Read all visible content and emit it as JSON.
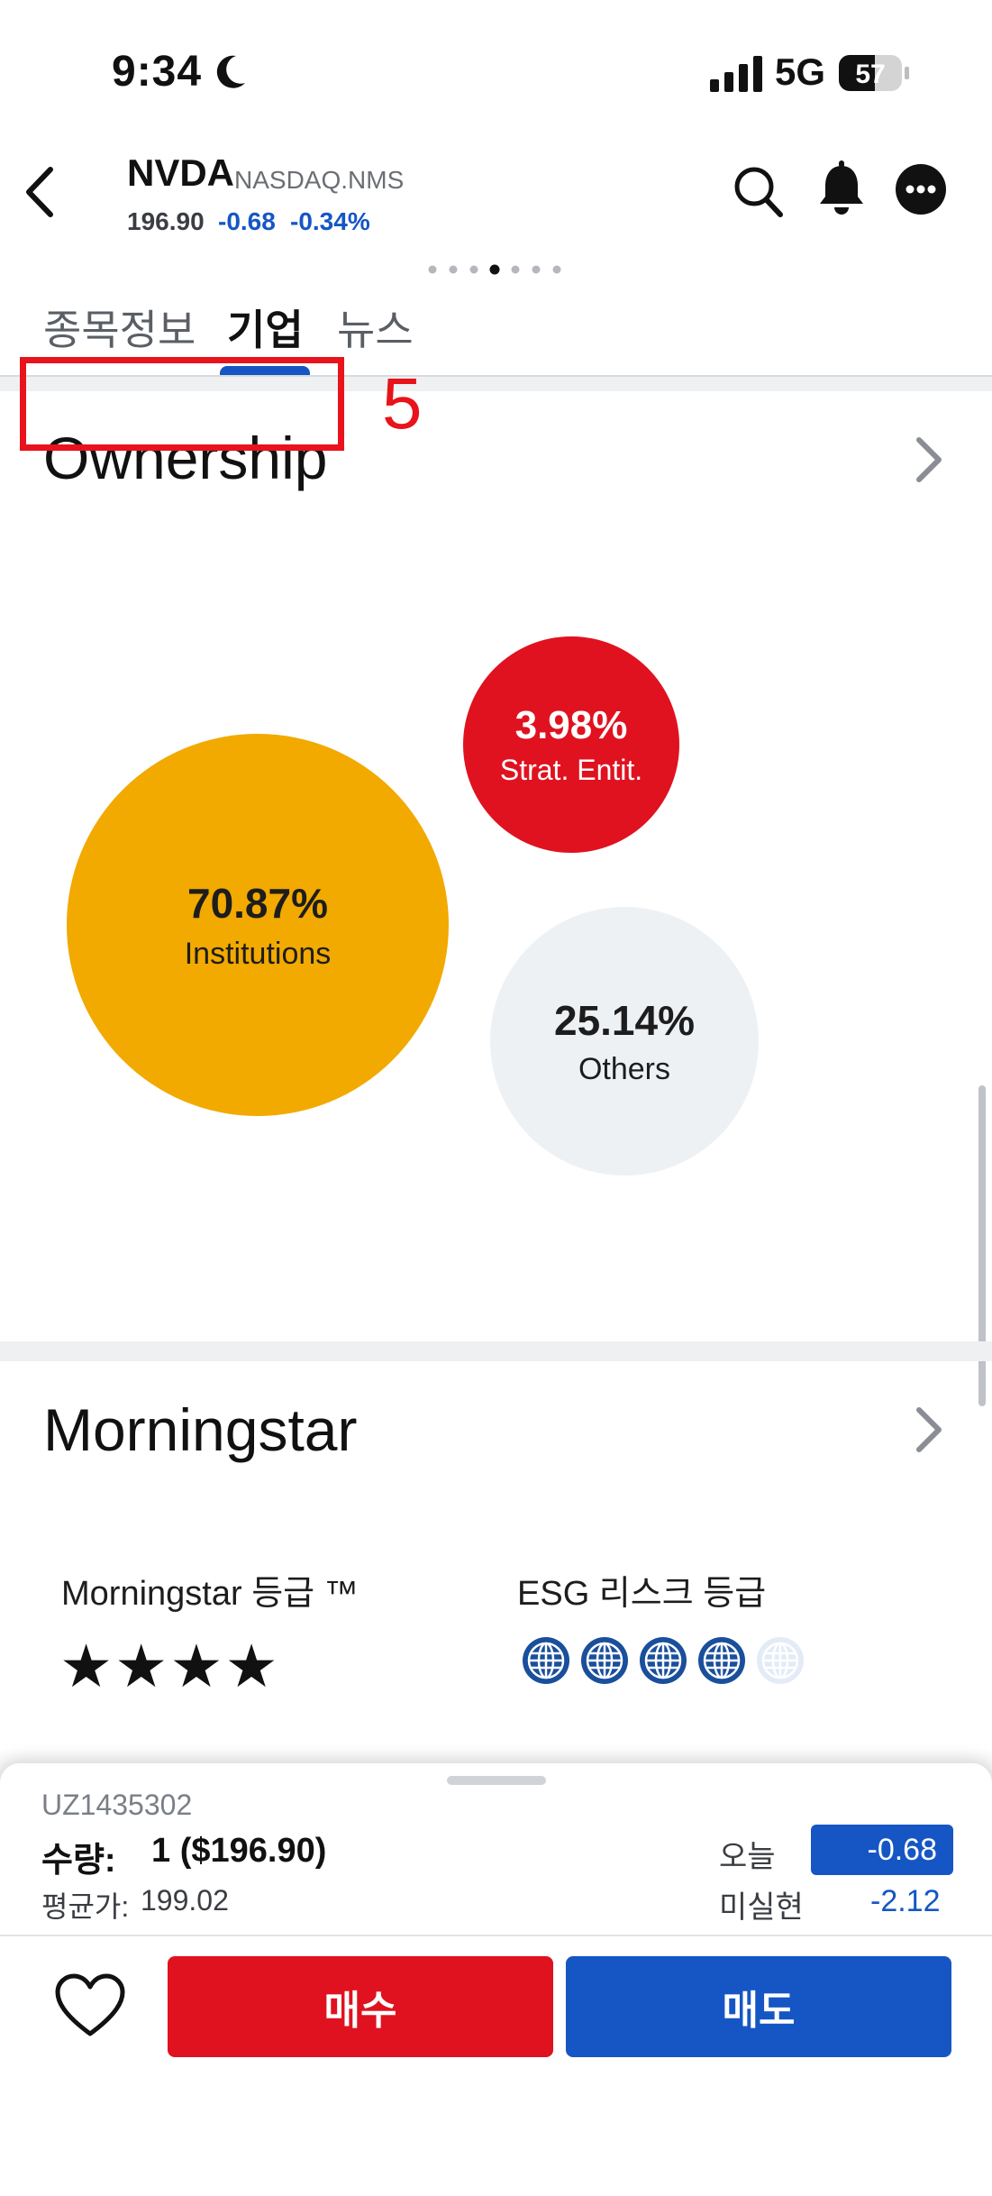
{
  "status_bar": {
    "time": "9:34",
    "network": "5G",
    "battery": "57"
  },
  "header": {
    "ticker": "NVDA",
    "exchange": "NASDAQ.NMS",
    "price": "196.90",
    "change": "-0.68",
    "change_pct": "-0.34%"
  },
  "page_dots": {
    "count": 7,
    "active_index": 3
  },
  "tabs": [
    {
      "label": "종목정보",
      "active": false
    },
    {
      "label": "기업",
      "active": true
    },
    {
      "label": "뉴스",
      "active": false
    }
  ],
  "annotation": {
    "number": "5",
    "color": "#e8131b"
  },
  "ownership": {
    "title": "Ownership",
    "institutions": {
      "value": "70.87%",
      "label": "Institutions",
      "color": "#f2a900"
    },
    "strategic": {
      "value": "3.98%",
      "label": "Strat. Entit.",
      "color": "#e0121f"
    },
    "others": {
      "value": "25.14%",
      "label": "Others",
      "color": "#eef1f4"
    }
  },
  "morningstar": {
    "title": "Morningstar",
    "rating_label": "Morningstar 등급 ™",
    "rating_stars": 4,
    "esg_label": "ESG 리스크 등급",
    "esg_globes": 4,
    "esg_globes_max": 5
  },
  "position": {
    "account": "UZ1435302",
    "qty_label": "수량:",
    "qty_value": "1 ($196.90)",
    "avg_label": "평균가:",
    "avg_value": "199.02",
    "today_label": "오늘",
    "today_value": "-0.68",
    "unrealized_label": "미실현",
    "unrealized_value": "-2.12"
  },
  "actions": {
    "buy_label": "매수",
    "sell_label": "매도"
  },
  "colors": {
    "accent_blue": "#1556c4",
    "red": "#e0121f",
    "gold": "#f2a900"
  }
}
